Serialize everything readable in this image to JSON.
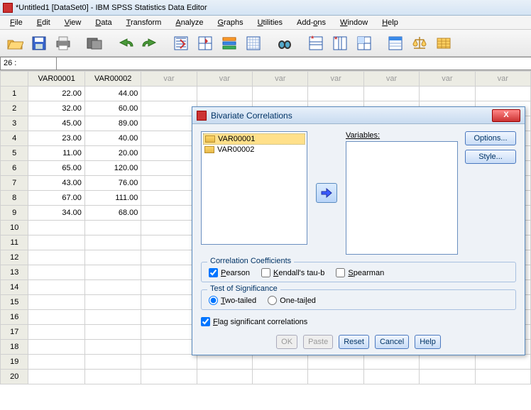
{
  "window": {
    "title": "*Untitled1 [DataSet0] - IBM SPSS Statistics Data Editor"
  },
  "menu": {
    "file": "File",
    "edit": "Edit",
    "view": "View",
    "data": "Data",
    "transform": "Transform",
    "analyze": "Analyze",
    "graphs": "Graphs",
    "utilities": "Utilities",
    "addons": "Add-ons",
    "window": "Window",
    "help": "Help"
  },
  "namebox": "26 :",
  "columns": {
    "c1": "VAR00001",
    "c2": "VAR00002",
    "empty": "var"
  },
  "rows": {
    "labels": [
      "1",
      "2",
      "3",
      "4",
      "5",
      "6",
      "7",
      "8",
      "9",
      "10",
      "11",
      "12",
      "13",
      "14",
      "15",
      "16",
      "17",
      "18",
      "19",
      "20"
    ],
    "data": [
      {
        "a": "22.00",
        "b": "44.00"
      },
      {
        "a": "32.00",
        "b": "60.00"
      },
      {
        "a": "45.00",
        "b": "89.00"
      },
      {
        "a": "23.00",
        "b": "40.00"
      },
      {
        "a": "11.00",
        "b": "20.00"
      },
      {
        "a": "65.00",
        "b": "120.00"
      },
      {
        "a": "43.00",
        "b": "76.00"
      },
      {
        "a": "67.00",
        "b": "111.00"
      },
      {
        "a": "34.00",
        "b": "68.00"
      }
    ]
  },
  "dialog": {
    "title": "Bivariate Correlations",
    "source_items": {
      "i0": "VAR00001",
      "i1": "VAR00002"
    },
    "variables_label": "Variables:",
    "options_btn": "Options...",
    "style_btn": "Style...",
    "group_cc": "Correlation Coefficients",
    "pearson": "Pearson",
    "kendall": "Kendall's tau-b",
    "spearman": "Spearman",
    "group_tos": "Test of Significance",
    "two_tailed": "Two-tailed",
    "one_tailed": "One-tailed",
    "flag": "Flag significant correlations",
    "ok": "OK",
    "paste": "Paste",
    "reset": "Reset",
    "cancel": "Cancel",
    "help": "Help"
  }
}
